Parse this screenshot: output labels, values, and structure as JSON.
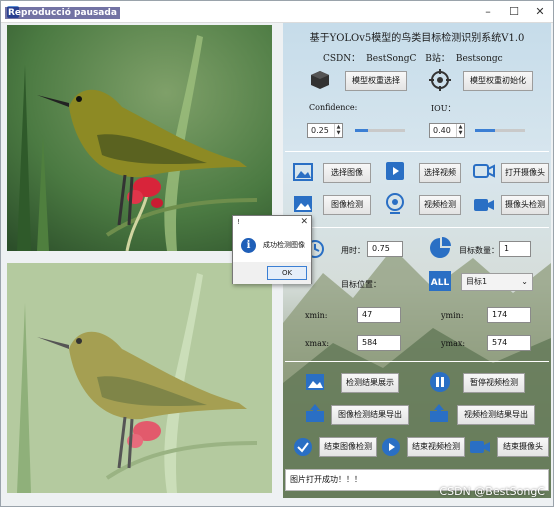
{
  "window": {
    "title": "Reproducció pausada"
  },
  "header": {
    "title": "基于YOLOv5模型的鸟类目标检测识别系统V1.0",
    "csdn_label": "CSDN：",
    "csdn_value": "BestSongC",
    "bili_label": "B站：",
    "bili_value": "Bestsongc"
  },
  "model": {
    "select_label": "模型权重选择",
    "init_label": "模型权重初始化",
    "confidence_label": "Confidence:",
    "confidence_value": "0.25",
    "confidence_level": 0.25,
    "iou_label": "IOU：",
    "iou_value": "0.40",
    "iou_level": 0.4
  },
  "input_buttons": {
    "select_image": "选择图像",
    "select_video": "选择视频",
    "open_camera": "打开摄像头",
    "image_detect": "图像检测",
    "video_detect": "视频检测",
    "camera_detect": "摄像头检测"
  },
  "results": {
    "time_label": "用时：",
    "time_value": "0.75",
    "count_label": "目标数量：",
    "count_value": "1",
    "position_label": "目标位置：",
    "target_select": "目标1",
    "xmin_label": "xmin:",
    "xmin_value": "47",
    "ymin_label": "ymin:",
    "ymin_value": "174",
    "xmax_label": "xmax:",
    "xmax_value": "584",
    "ymax_label": "ymax:",
    "ymax_value": "574"
  },
  "actions": {
    "show_result": "检测结果展示",
    "pause_video": "暂停视频检测",
    "export_image": "图像检测结果导出",
    "export_video": "视频检测结果导出",
    "end_image": "结束图像检测",
    "end_video": "结束视频检测",
    "end_camera": "结束摄像头"
  },
  "status": {
    "text": "图片打开成功！！！"
  },
  "dialog": {
    "title": "!",
    "message": "成功检测图像",
    "ok_label": "OK"
  },
  "watermark": "CSDN @BestSongC"
}
